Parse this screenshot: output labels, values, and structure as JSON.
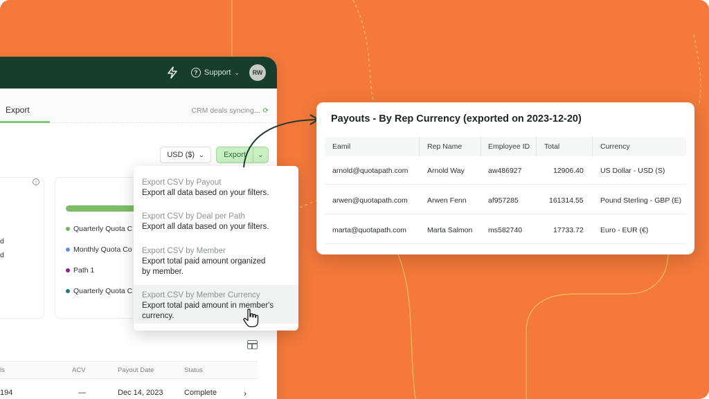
{
  "app": {
    "support_label": "Support",
    "avatar_initials": "RW",
    "tab_label": "Export",
    "sync_text": "CRM deals syncing...",
    "currency_select": "USD ($)",
    "export_button": "Export",
    "left_fragments": [
      "d",
      "d"
    ],
    "legend": [
      {
        "label": "Quarterly Quota C",
        "color": "#6dbb5c"
      },
      {
        "label": "Monthly Quota Co",
        "color": "#6a8fe0"
      },
      {
        "label": "Path 1",
        "color": "#8b1f8f"
      },
      {
        "label": "Quarterly Quota C",
        "color": "#1f7a7a"
      }
    ],
    "table": {
      "headers": [
        "ls",
        "ACV",
        "Payout Date",
        "Status"
      ],
      "row": [
        "194",
        "—",
        "Dec 14, 2023",
        "Complete"
      ]
    }
  },
  "dropdown": {
    "items": [
      {
        "title": "Export CSV by Payout",
        "desc": "Export all data based on your filters."
      },
      {
        "title": "Export CSV by Deal per Path",
        "desc": "Export all data based on your filters."
      },
      {
        "title": "Export CSV by Member",
        "desc": "Export total paid amount organized",
        "desc2": "by member."
      },
      {
        "title": "Export CSV by Member Currency",
        "desc": "Export total paid amount in member's",
        "desc2": "currency."
      }
    ]
  },
  "payout": {
    "title": "Payouts - By Rep Currency (exported on 2023-12-20)",
    "headers": [
      "Eamil",
      "Rep Name",
      "Employee ID",
      "Total",
      "Currency"
    ],
    "rows": [
      [
        "arnold@quotapath.com",
        "Arnold Way",
        "aw486927",
        "12906.40",
        "US Dollar - USD (S)"
      ],
      [
        "arwen@quotapath.com",
        "Arwen Fenn",
        "af957285",
        "161314.55",
        "Pound Sterling - GBP (E)"
      ],
      [
        "marta@quotapath.com",
        "Marta Salmon",
        "ms582740",
        "17733.72",
        "Euro - EUR (€)"
      ]
    ]
  },
  "colors": {
    "background": "#f4793b",
    "topbar": "#173d2e",
    "accent_green": "#7dbd6a"
  }
}
